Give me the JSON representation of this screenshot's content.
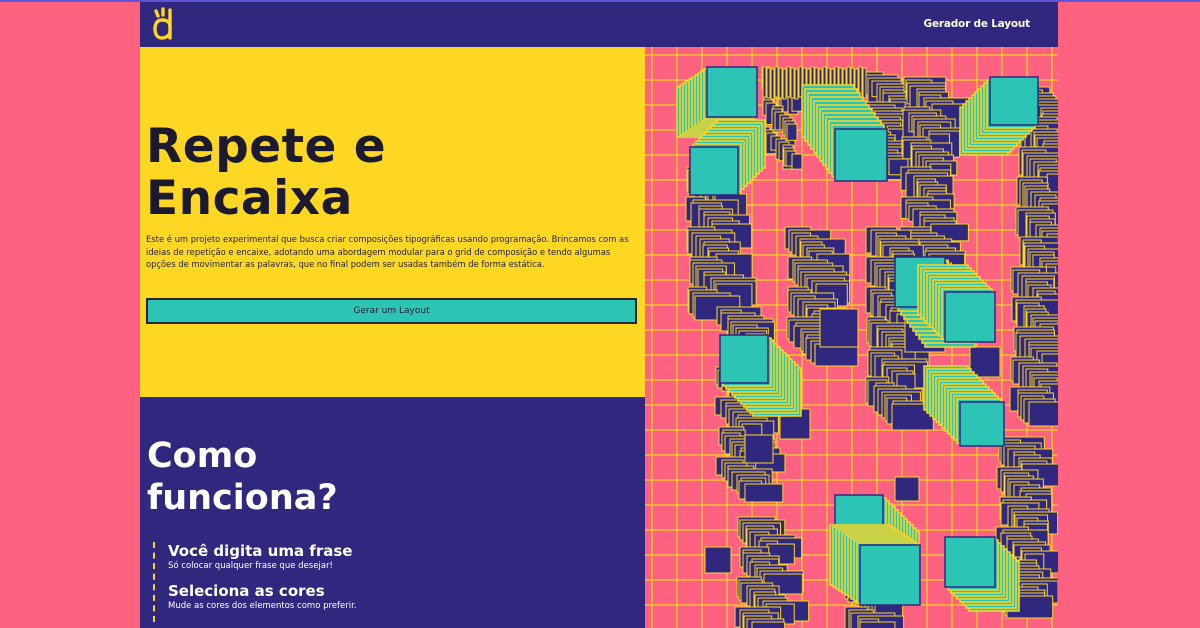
{
  "colors": {
    "page_bg": "#ff6181",
    "navbar": "#30287f",
    "hero_bg": "#fdd721",
    "accent_teal": "#2cc4b5",
    "art_pink": "#ff6181",
    "art_navy": "#30287f",
    "art_yellow": "#fdd721"
  },
  "navbar": {
    "logo_icon": "yellow-hand-logo",
    "link_label": "Gerador de Layout"
  },
  "hero": {
    "title_line1": "Repete e",
    "title_line2": "Encaixa",
    "description": "Este é um projeto experimental que busca criar composições tipográficas usando programação. Brincamos com as ideias de repetição e encaixe, adotando uma abordagem modular para o grid de composição e tendo algumas opções de movimentar as palavras, que no final podem ser usadas também de forma estática.",
    "cta_label": "Gerar um Layout"
  },
  "how_it_works": {
    "title_line1": "Como",
    "title_line2": "funciona?",
    "steps": [
      {
        "title": "Você digita uma frase",
        "description": "Só colocar qualquer frase que desejar!"
      },
      {
        "title": "Seleciona as cores",
        "description": "Mude as cores dos elementos como preferir."
      }
    ]
  }
}
